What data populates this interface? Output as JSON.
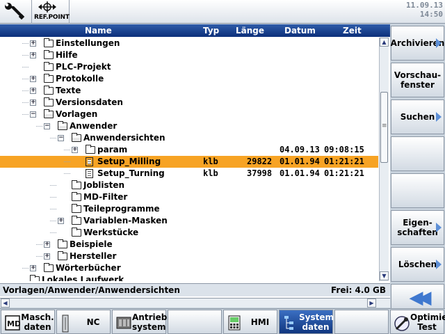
{
  "topbar": {
    "ref_label": "REF.POINT",
    "date": "11.09.13",
    "time": "14:50"
  },
  "columns": {
    "name": "Name",
    "type": "Typ",
    "length": "Länge",
    "date": "Datum",
    "time": "Zeit"
  },
  "tree": [
    {
      "label": "Einstellungen",
      "level": 1,
      "expander": "+",
      "icon": "folder-icon"
    },
    {
      "label": "Hilfe",
      "level": 1,
      "expander": "+",
      "icon": "folder-icon"
    },
    {
      "label": "PLC-Projekt",
      "level": 1,
      "expander": "",
      "icon": "folder-icon"
    },
    {
      "label": "Protokolle",
      "level": 1,
      "expander": "+",
      "icon": "folder-icon"
    },
    {
      "label": "Texte",
      "level": 1,
      "expander": "+",
      "icon": "folder-icon"
    },
    {
      "label": "Versionsdaten",
      "level": 1,
      "expander": "+",
      "icon": "folder-icon"
    },
    {
      "label": "Vorlagen",
      "level": 1,
      "expander": "-",
      "icon": "folder-open-icon"
    },
    {
      "label": "Anwender",
      "level": 2,
      "expander": "-",
      "icon": "folder-open-icon"
    },
    {
      "label": "Anwendersichten",
      "level": 3,
      "expander": "-",
      "icon": "folder-open-icon"
    },
    {
      "label": "param",
      "level": 4,
      "expander": "+",
      "icon": "folder-icon",
      "date": "04.09.13",
      "time": "09:08:15"
    },
    {
      "label": "Setup_Milling",
      "level": 4,
      "expander": "",
      "icon": "file-icon",
      "type": "klb",
      "length": "29822",
      "date": "01.01.94",
      "time": "01:21:21",
      "selected": true
    },
    {
      "label": "Setup_Turning",
      "level": 4,
      "expander": "",
      "icon": "file-icon",
      "type": "klb",
      "length": "37998",
      "date": "01.01.94",
      "time": "01:21:21"
    },
    {
      "label": "Joblisten",
      "level": 3,
      "expander": "",
      "icon": "folder-icon"
    },
    {
      "label": "MD-Filter",
      "level": 3,
      "expander": "",
      "icon": "folder-icon"
    },
    {
      "label": "Teileprogramme",
      "level": 3,
      "expander": "",
      "icon": "folder-icon"
    },
    {
      "label": "Variablen-Masken",
      "level": 3,
      "expander": "+",
      "icon": "folder-icon"
    },
    {
      "label": "Werkstücke",
      "level": 3,
      "expander": "",
      "icon": "folder-icon"
    },
    {
      "label": "Beispiele",
      "level": 2,
      "expander": "+",
      "icon": "folder-icon"
    },
    {
      "label": "Hersteller",
      "level": 2,
      "expander": "+",
      "icon": "folder-icon"
    },
    {
      "label": "Wörterbücher",
      "level": 1,
      "expander": "+",
      "icon": "folder-icon"
    },
    {
      "label": "Lokales Laufwerk",
      "level": 0,
      "expander": "",
      "icon": "folder-icon"
    }
  ],
  "status": {
    "path": "Vorlagen/Anwender/Anwendersichten",
    "free": "Frei: 4.0 GB"
  },
  "vertical_softkeys": [
    {
      "name": "archive-button",
      "label": "Archivieren",
      "arrow": true
    },
    {
      "name": "preview-button",
      "label": "Vorschau-\nfenster",
      "arrow": false
    },
    {
      "name": "search-button",
      "label": "Suchen",
      "arrow": true
    },
    {
      "name": "empty-softkey-4",
      "label": "",
      "arrow": false
    },
    {
      "name": "empty-softkey-5",
      "label": "",
      "arrow": false
    },
    {
      "name": "properties-button",
      "label": "Eigen-\nschaften",
      "arrow": true
    },
    {
      "name": "delete-button",
      "label": "Löschen",
      "arrow": true
    }
  ],
  "horizontal_softkeys": [
    {
      "name": "machine-data-button",
      "label": "Masch.\ndaten",
      "icon": "md-icon"
    },
    {
      "name": "nc-button",
      "label": "NC",
      "icon": "nc-icon"
    },
    {
      "name": "drive-system-button",
      "label": "Antriebs\nsystem",
      "icon": "drive-icon"
    },
    {
      "name": "empty-hsk-4",
      "label": "",
      "icon": ""
    },
    {
      "name": "hmi-button",
      "label": "HMI",
      "icon": "hmi-icon"
    },
    {
      "name": "system-data-button",
      "label": "System\ndaten",
      "icon": "tree-icon",
      "active": true
    },
    {
      "name": "empty-hsk-7",
      "label": "",
      "icon": ""
    },
    {
      "name": "optimize-test-button",
      "label": "Optimie.\nTest",
      "icon": "optimize-icon"
    }
  ],
  "colors": {
    "header": "#0c2f7a",
    "selection": "#f7a324",
    "active_softkey": "#10367f",
    "arrow": "#5d8fd6"
  }
}
